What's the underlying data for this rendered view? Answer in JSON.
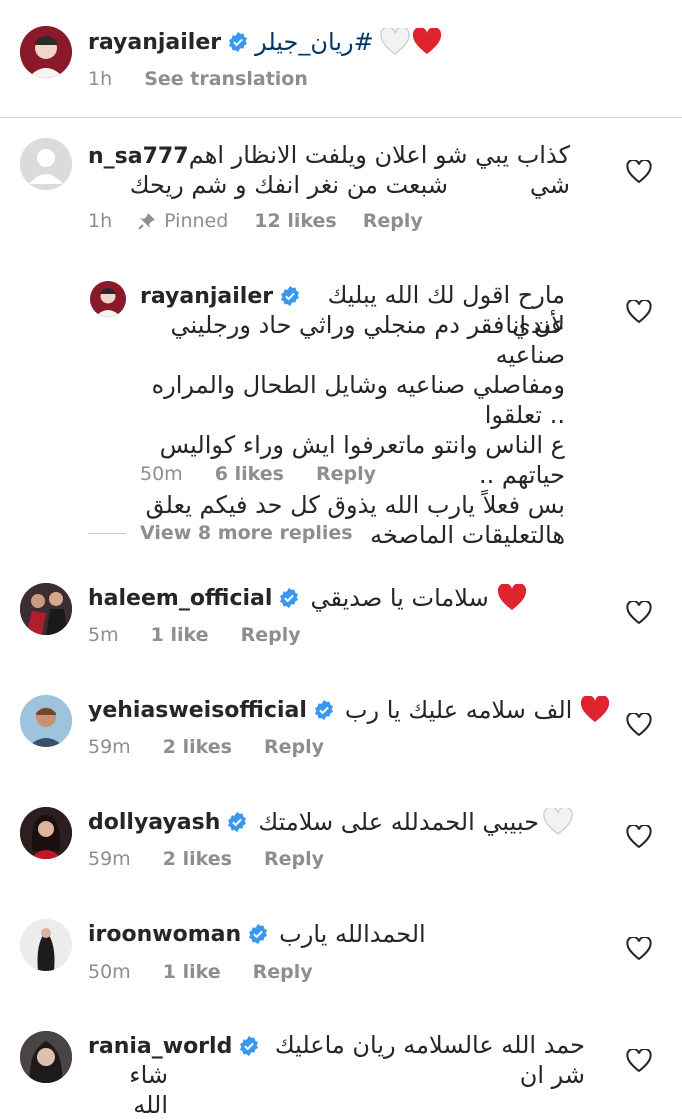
{
  "caption": {
    "username": "rayanjailer",
    "text": "#ريان_جيلر",
    "time": "1h",
    "see_translation": "See translation"
  },
  "comments": [
    {
      "username": "n_sa777",
      "text_lines": [
        "كذاب يبي شو اعلان ويلفت الانظار اهم شي",
        "شبعت من نغر انفك و شم ريحك"
      ],
      "time": "1h",
      "pinned": "Pinned",
      "likes": "12 likes",
      "reply": "Reply"
    },
    {
      "username": "rayanjailer",
      "text_lines": [
        "مارح اقول لك الله يبليك لأن انا",
        "عندي فقر دم منجلي وراثي حاد ورجليني صناعيه",
        "ومفاصلي صناعيه وشايل الطحال والمراره .. تعلقوا",
        "ع الناس وانتو ماتعرفوا ايش وراء كواليس حياتهم ..",
        "بس فعلاً يارب الله يذوق كل حد فيكم يعلق",
        "هالتعليقات الماصخه"
      ],
      "time": "50m",
      "likes": "6 likes",
      "reply": "Reply"
    },
    {
      "username": "haleem_official",
      "text": "سلامات يا صديقي",
      "time": "5m",
      "likes": "1 like",
      "reply": "Reply"
    },
    {
      "username": "yehiasweisofficial",
      "text": "الف سلامه عليك يا رب",
      "time": "59m",
      "likes": "2 likes",
      "reply": "Reply"
    },
    {
      "username": "dollyayash",
      "text": "حبيبي الحمدلله على سلامتك",
      "time": "59m",
      "likes": "2 likes",
      "reply": "Reply"
    },
    {
      "username": "iroonwoman",
      "text": "الحمدالله يارب",
      "time": "50m",
      "likes": "1 like",
      "reply": "Reply"
    },
    {
      "username": "rania_world",
      "text_lines": [
        "حمد الله عالسلامه ريان ماعليك شر ان",
        "شاء الله"
      ]
    }
  ],
  "view_more_replies": "View 8 more replies",
  "colors": {
    "verified": "#3897f0",
    "red_heart": "#e0242f",
    "secondary_text": "#8e8e8e"
  }
}
